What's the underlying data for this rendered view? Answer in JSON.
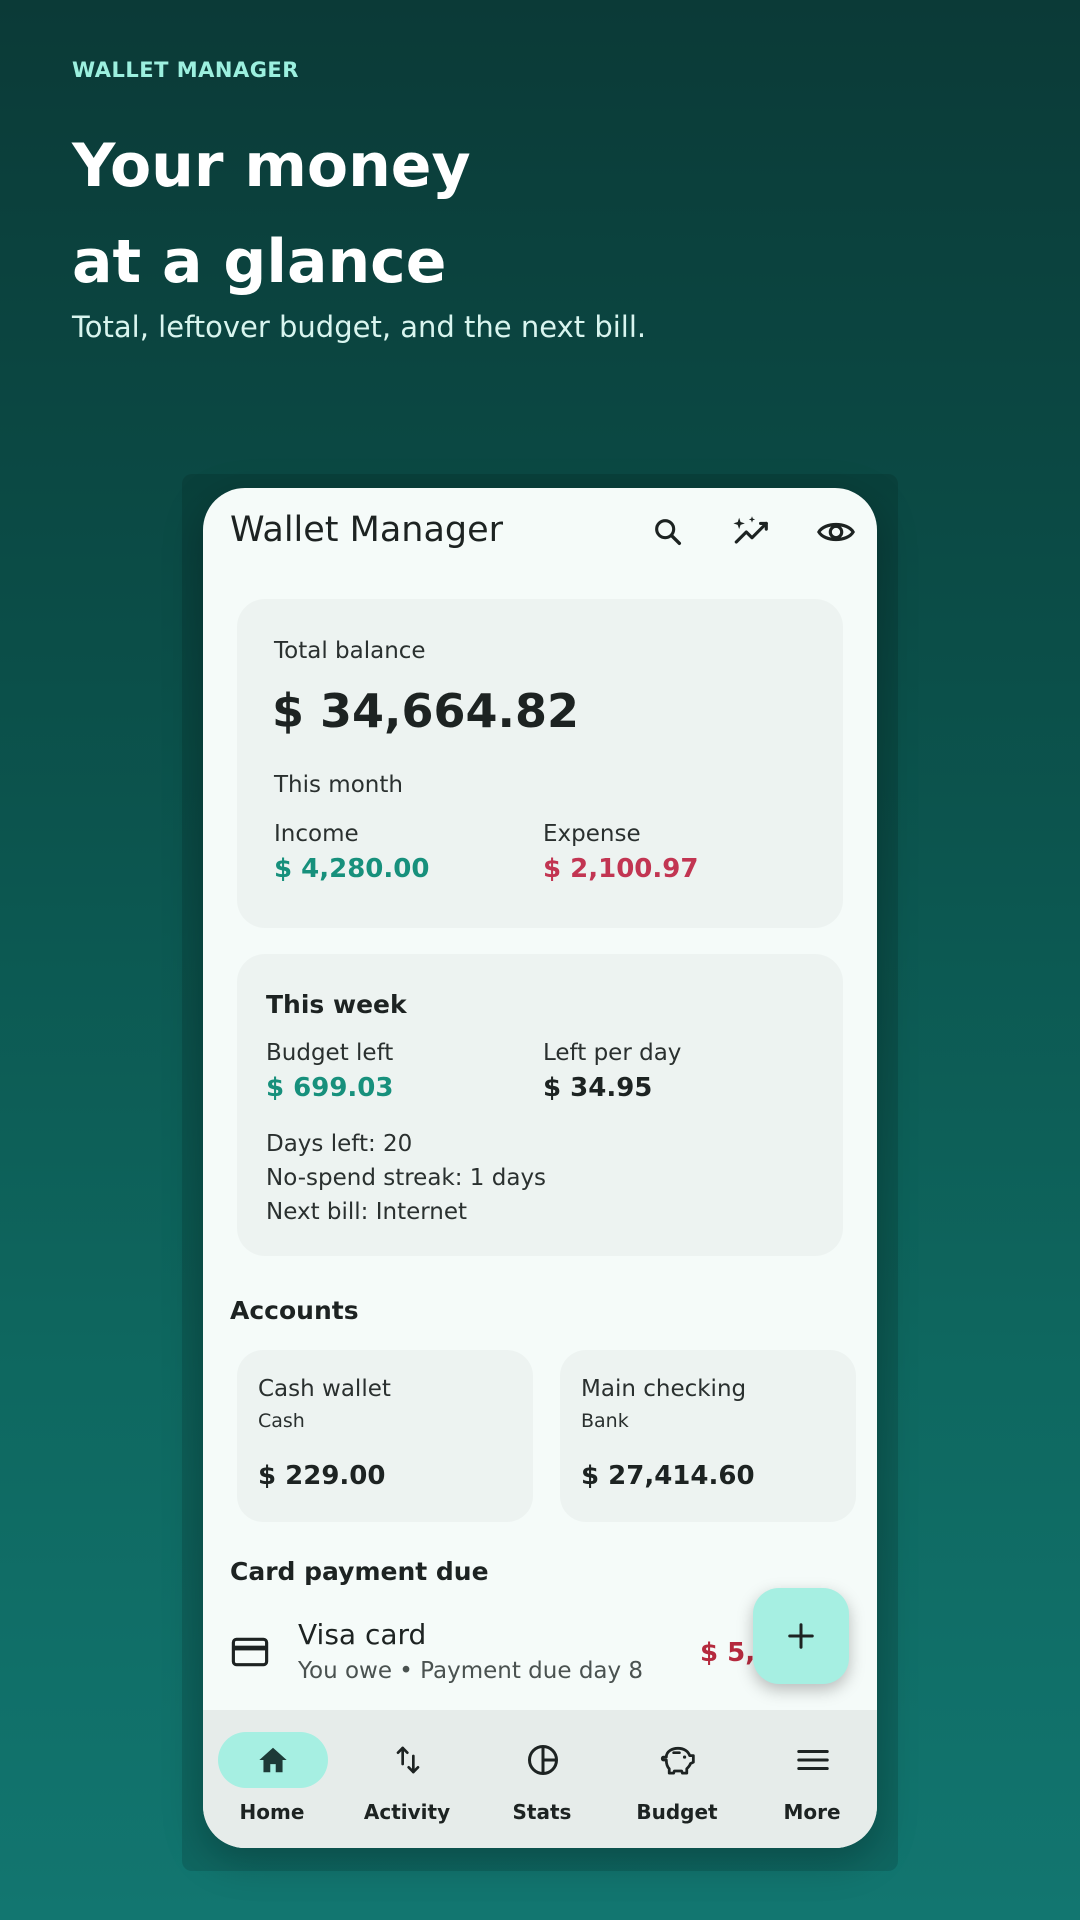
{
  "promo": {
    "kicker": "WALLET MANAGER",
    "title_line1": "Your money",
    "title_line2": "at a glance",
    "subtitle": "Total, leftover budget, and the next bill."
  },
  "appbar": {
    "title": "Wallet Manager",
    "icons": [
      "search-icon",
      "sparkle-chart-icon",
      "eye-icon"
    ]
  },
  "balance": {
    "label": "Total balance",
    "amount": "$ 34,664.82",
    "period": "This month",
    "income_label": "Income",
    "income_amount": "$ 4,280.00",
    "expense_label": "Expense",
    "expense_amount": "$ 2,100.97"
  },
  "week": {
    "title": "This week",
    "budget_left_label": "Budget left",
    "budget_left_amount": "$ 699.03",
    "per_day_label": "Left per day",
    "per_day_amount": "$ 34.95",
    "days_left": "Days left: 20",
    "streak": "No-spend streak: 1 days",
    "next_bill": "Next bill: Internet"
  },
  "accounts": {
    "title": "Accounts",
    "items": [
      {
        "name": "Cash wallet",
        "type": "Cash",
        "amount": "$ 229.00"
      },
      {
        "name": "Main checking",
        "type": "Bank",
        "amount": "$ 27,414.60"
      }
    ]
  },
  "card_payment": {
    "title": "Card payment due",
    "name": "Visa card",
    "detail": "You owe • Payment due day 8",
    "amount_visible": "$ 5,4"
  },
  "fab": {
    "icon": "plus-icon"
  },
  "nav": {
    "items": [
      {
        "label": "Home",
        "icon": "home-icon",
        "active": true
      },
      {
        "label": "Activity",
        "icon": "swap-vertical-icon",
        "active": false
      },
      {
        "label": "Stats",
        "icon": "pie-chart-icon",
        "active": false
      },
      {
        "label": "Budget",
        "icon": "piggy-bank-icon",
        "active": false
      },
      {
        "label": "More",
        "icon": "menu-icon",
        "active": false
      }
    ]
  },
  "colors": {
    "accent": "#a6efe2",
    "income": "#17907c",
    "expense": "#c23552",
    "background_top": "#0b3a37",
    "background_bottom": "#127670"
  }
}
